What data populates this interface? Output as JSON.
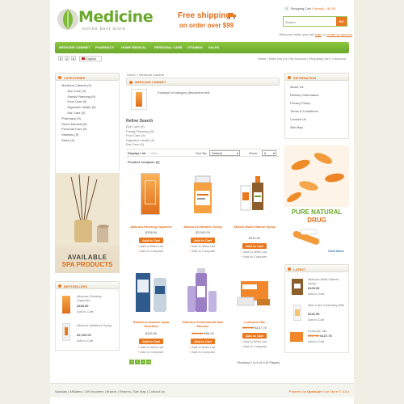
{
  "header": {
    "logo_title": "Medicine",
    "logo_tagline": "online best store",
    "promo_line1": "Free shipping",
    "promo_line2": "on order over $99",
    "cart_label": "Shopping Cart",
    "cart_summary": "0 item(s) - $0.00",
    "search_placeholder": "Search",
    "search_button": "GO",
    "welcome_text": "Welcome visitor you can",
    "login_link": "login",
    "or_text": "or",
    "create_link": "create an account",
    "colors": {
      "nav_green": "#78b62d",
      "accent_orange": "#e9781f",
      "logo_green": "#6aa92c"
    }
  },
  "nav": {
    "items": [
      "MEDICINE CABINET",
      "PHARMACY",
      "HOME MEDICAL",
      "PERSONAL CARE",
      "VITAMINS",
      "SALES"
    ]
  },
  "topbar": {
    "currency_options": [
      "€",
      "£",
      "$"
    ],
    "language": "English",
    "links": [
      "Home",
      "Wish List (0)",
      "My Account",
      "Shopping Cart",
      "Checkout"
    ]
  },
  "categories": {
    "title": "CATEGORIES",
    "main": "Medicine Cabinet (9)",
    "subs": [
      "Eye Care (9)",
      "Family Planning (9)",
      "Foot Care (9)",
      "Digestive Health (9)",
      "Ear Care (9)"
    ],
    "others": [
      "Pharmacy (9)",
      "Home Medical (9)",
      "Personal Care (9)",
      "Vitamins (9)",
      "Sales (9)"
    ]
  },
  "spa_banner": {
    "line1": "AVAILABLE",
    "line2": "SPA PRODUCTS"
  },
  "bestsellers": {
    "title": "BESTSELLERS",
    "items": [
      {
        "name": "Allacura Ginseng Capsules",
        "price": "$338.99",
        "cta": "Add to Cart"
      },
      {
        "name": "Allacura Inhibitors Syrup",
        "price": "$2,000.00",
        "cta": "Add to Cart"
      }
    ]
  },
  "breadcrumb": {
    "home": "Home",
    "sep": "»",
    "current": "Medicine Cabinet"
  },
  "main": {
    "title": "MEDICINE CABINET",
    "description": "Example of category description text",
    "refine_title": "Refine Search",
    "refine_links": [
      "Eye Care (9)",
      "Family Planning (9)",
      "Foot Care (9)",
      "Digestive Health (9)",
      "Ear Care (9)"
    ],
    "display_label": "Display List",
    "display_grid": "Grid",
    "sort_label": "Sort By:",
    "sort_value": "Default",
    "show_label": "Show:",
    "show_value": "6",
    "compare": "Product Compare (0)",
    "products": [
      {
        "name": "Allacura Ginseng Capsules",
        "price": "$338.99",
        "old": "",
        "cta": "Add to Cart",
        "wish": "Add to Wish List",
        "compare": "Add to Compare"
      },
      {
        "name": "Allacura Inhibitors Syrup",
        "price": "$2,000.00",
        "old": "",
        "cta": "Add to Cart",
        "wish": "Add to Wish List",
        "compare": "Add to Compare"
      },
      {
        "name": "Allacin Multi-Vitamin Syrup",
        "price": "$119.50",
        "old": "",
        "cta": "Add to Cart",
        "wish": "Add to Wish List",
        "compare": "Add to Compare"
      },
      {
        "name": "Biotherm Homme Aqua Sensitive",
        "price": "$119.50",
        "old": "",
        "cta": "Add to Cart",
        "wish": "Add to Wish List",
        "compare": "Add to Compare"
      },
      {
        "name": "Glamour Professional Hair Mousse",
        "price": "$96.00",
        "old": "$119.50",
        "cta": "Add to Cart",
        "wish": "Add to Wish List",
        "compare": "Add to Compare"
      },
      {
        "name": "Lecitonis Tab",
        "price": "$107.75",
        "old": "$119.50",
        "cta": "Add to Cart",
        "wish": "Add to Wish List",
        "compare": "Add to Compare"
      }
    ],
    "pages": [
      "1",
      "2",
      ">",
      ">|"
    ],
    "showing": "Showing 1 to 6 of 9 (2 Pages)"
  },
  "information": {
    "title": "INFORMATION",
    "links": [
      "About Us",
      "Delivery Information",
      "Privacy Policy",
      "Terms & Conditions",
      "Contact Us",
      "Site Map"
    ]
  },
  "drug_banner": {
    "line1": "PURE NATURAL",
    "line2": "DRUG",
    "cta": "View More"
  },
  "latest": {
    "title": "LATEST",
    "items": [
      {
        "name": "Allacura Multi-Vitamin Syrup",
        "price": "$109.50",
        "old": "",
        "cta": "Add to Cart"
      },
      {
        "name": "Skin Care Cleansing Milk",
        "price": "$109.50",
        "old": "",
        "cta": "Add to Cart"
      },
      {
        "name": "Lecitonis Tab",
        "price": "$107.75",
        "old": "$119.50",
        "cta": "Add to Cart"
      }
    ]
  },
  "footer": {
    "links": [
      "Specials",
      "Affiliates",
      "Gift Vouchers",
      "Brands",
      "Returns",
      "Site Map",
      "Contact Us"
    ],
    "powered_prefix": "Powered by",
    "powered_link": "OpenCart",
    "powered_suffix": "Your Store © 2014"
  }
}
